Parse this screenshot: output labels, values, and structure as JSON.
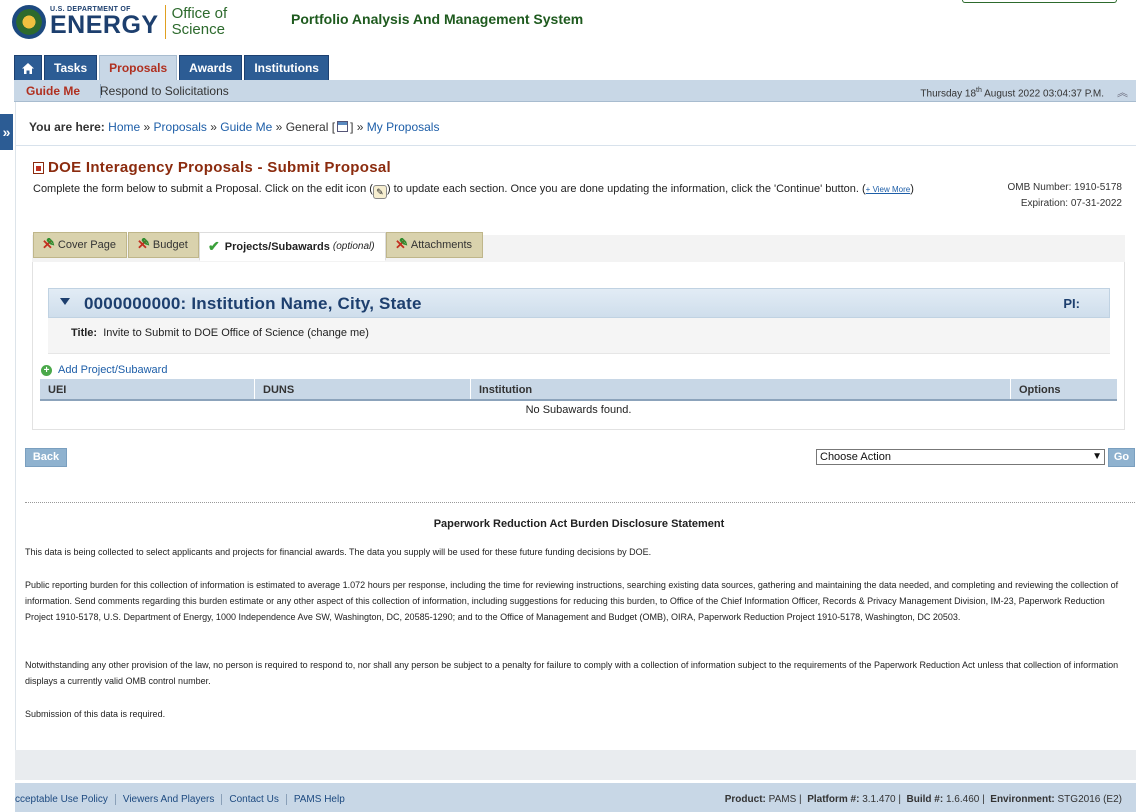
{
  "header": {
    "logo_small": "U.S. DEPARTMENT OF",
    "logo_big": "ENERGY",
    "logo_office_1": "Office of",
    "logo_office_2": "Science",
    "app_title": "Portfolio Analysis And Management System"
  },
  "main_tabs": {
    "tasks": "Tasks",
    "proposals": "Proposals",
    "awards": "Awards",
    "institutions": "Institutions"
  },
  "subnav": {
    "guide_me": "Guide Me",
    "respond": "Respond to Solicitations",
    "date_prefix": "Thursday 18",
    "date_sup": "th",
    "date_suffix": " August 2022 03:04:37 P.M."
  },
  "breadcrumb": {
    "label": "You are here:",
    "home": "Home",
    "proposals": "Proposals",
    "guide_me": "Guide Me",
    "general_pre": "General [",
    "general_post": "]",
    "my_proposals": "My Proposals",
    "sep": "»"
  },
  "page": {
    "title": "DOE Interagency Proposals - Submit Proposal",
    "instructions_a": "Complete the form below to submit a Proposal. Click on the edit icon (",
    "instructions_b": ") to update each section. Once you are done updating the information, click the 'Continue' button. (",
    "view_more": "+ View More",
    "instructions_c": ")",
    "omb_number": "OMB Number: 1910-5178",
    "expiration": "Expiration: 07-31-2022"
  },
  "section_tabs": {
    "cover_page": "Cover Page",
    "budget": "Budget",
    "projects": "Projects/Subawards",
    "projects_optional": "(optional)",
    "attachments": "Attachments"
  },
  "institution": {
    "name": "0000000000: Institution Name, City, State",
    "pi_label": "PI:",
    "title_label": "Title:",
    "title_value": "Invite to Submit to DOE Office of Science (change me)"
  },
  "subawards": {
    "add_label": "Add Project/Subaward",
    "columns": [
      "UEI",
      "DUNS",
      "Institution",
      "Options"
    ],
    "empty_message": "No Subawards found."
  },
  "actions": {
    "back": "Back",
    "select_value": "Choose Action",
    "go": "Go"
  },
  "pra": {
    "heading": "Paperwork Reduction Act Burden Disclosure Statement",
    "p1": "This data is being collected to select applicants and projects for financial awards. The data you supply will be used for these future funding decisions by DOE.",
    "p2": "Public reporting burden for this collection of information is estimated to average 1.072 hours per response, including the time for reviewing instructions, searching existing data sources, gathering and maintaining the data needed, and completing and reviewing the collection of information. Send comments regarding this burden estimate or any other aspect of this collection of information, including suggestions for reducing this burden, to Office of the Chief Information Officer, Records & Privacy Management Division, IM-23, Paperwork Reduction Project 1910-5178, U.S. Department of Energy, 1000 Independence Ave SW, Washington, DC, 20585-1290; and to the Office of Management and Budget (OMB), OIRA, Paperwork Reduction Project 1910-5178, Washington, DC 20503.",
    "p3": "Notwithstanding any other provision of the law, no person is required to respond to, nor shall any person be subject to a penalty for failure to comply with a collection of information subject to the requirements of the Paperwork Reduction Act unless that collection of information displays a currently valid OMB control number.",
    "p4": "Submission of this data is required."
  },
  "footer": {
    "links": [
      "cceptable Use Policy",
      "Viewers And Players",
      "Contact Us",
      "PAMS Help"
    ],
    "product_label": "Product:",
    "product": "PAMS",
    "platform_label": "Platform #:",
    "platform": "3.1.470",
    "build_label": "Build #:",
    "build": "1.6.460",
    "env_label": "Environment:",
    "env": "STG2016 (E2)"
  },
  "colors": {
    "nav_blue": "#2c5c94",
    "subnav_bg": "#c8d7e6",
    "title_brown": "#8b2b0e",
    "active_red": "#b03020",
    "header_green": "#1e5a1e"
  }
}
